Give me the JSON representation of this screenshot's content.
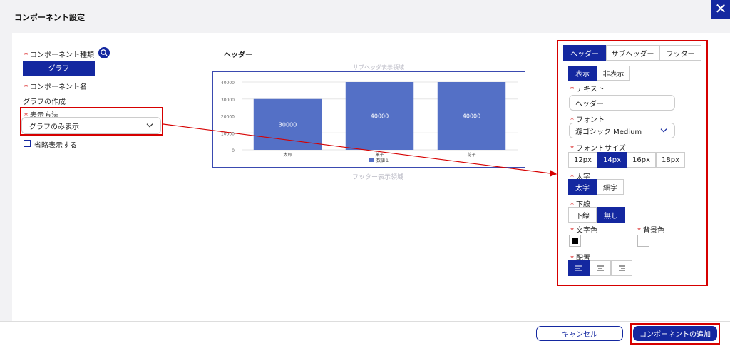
{
  "header": {
    "title": "コンポーネント設定"
  },
  "left": {
    "component_type_label": "コンポーネント種類",
    "component_type_value": "グラフ",
    "component_name_label": "コンポーネント名",
    "graph_creation_label": "グラフの作成",
    "display_method_label": "表示方法",
    "display_method_value": "グラフのみ表示",
    "abbrev_label": "省略表示する"
  },
  "preview": {
    "header_label": "ヘッダー",
    "subheader_area": "サブヘッダ表示領域",
    "footer_area": "フッター表示領域"
  },
  "chart_data": {
    "type": "bar",
    "categories": [
      "太郎",
      "菓子",
      "花子"
    ],
    "series": [
      {
        "name": "数値１",
        "values": [
          30000,
          40000,
          40000
        ]
      }
    ],
    "ylim": [
      0,
      40000
    ],
    "yticks": [
      "40000",
      "30000",
      "20000",
      "10000",
      "0"
    ],
    "data_labels": [
      "30000",
      "40000",
      "40000"
    ],
    "bar_color": "#5470c6",
    "legend_position": "bottom"
  },
  "right": {
    "tabs": [
      {
        "label": "ヘッダー",
        "active": true
      },
      {
        "label": "サブヘッダー",
        "active": false
      },
      {
        "label": "フッター",
        "active": false
      }
    ],
    "visibility": {
      "show": "表示",
      "hide": "非表示"
    },
    "text_label": "テキスト",
    "text_value": "ヘッダー",
    "font_label": "フォント",
    "font_value": "游ゴシック Medium",
    "font_size_label": "フォントサイズ",
    "font_sizes": [
      "12px",
      "14px",
      "16px",
      "18px"
    ],
    "font_size_selected": "14px",
    "bold_label": "太字",
    "bold_options": [
      "太字",
      "細字"
    ],
    "underline_label": "下線",
    "underline_options": [
      "下線",
      "無し"
    ],
    "text_color_label": "文字色",
    "text_color": "#000000",
    "bg_color_label": "背景色",
    "bg_color": "#ffffff",
    "align_label": "配置"
  },
  "footer": {
    "cancel_label": "キャンセル",
    "add_label": "コンポーネントの追加"
  },
  "colors": {
    "accent": "#1428a0",
    "highlight": "#d60000"
  }
}
